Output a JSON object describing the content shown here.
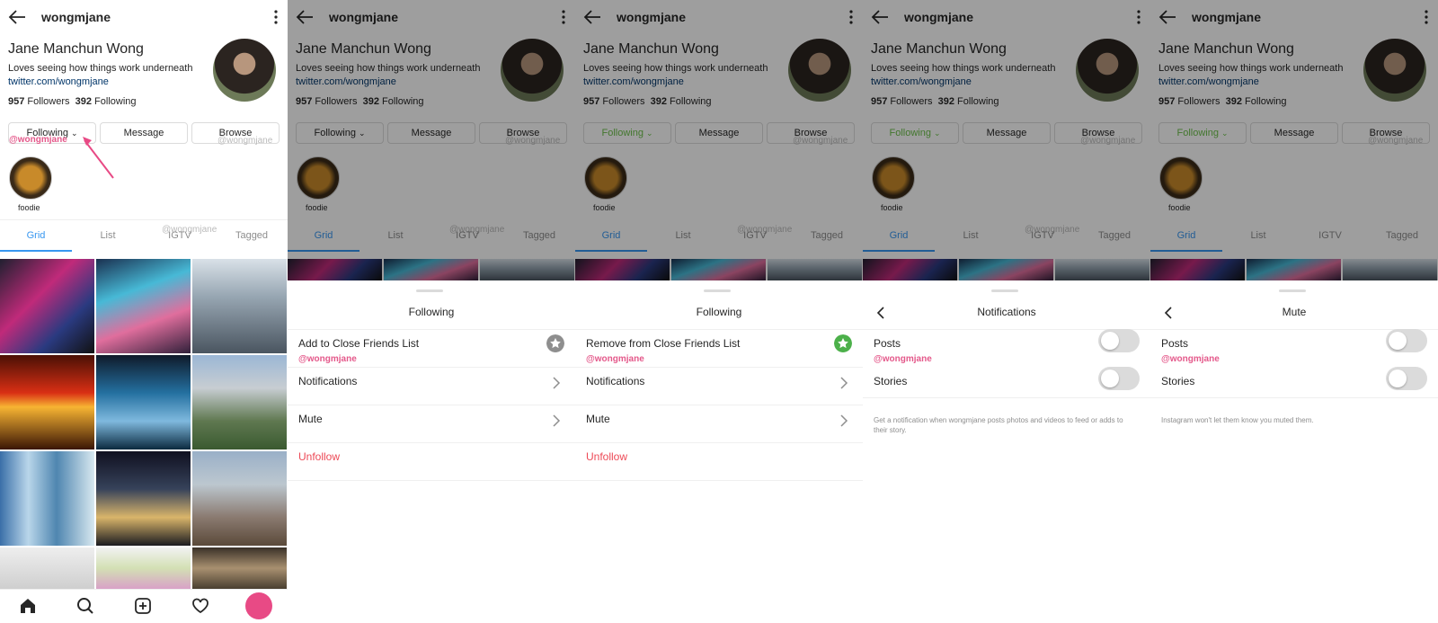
{
  "profile": {
    "username": "wongmjane",
    "full_name": "Jane Manchun Wong",
    "bio": "Loves seeing how things work underneath",
    "link": "twitter.com/wongmjane",
    "followers_count": "957",
    "followers_label": "Followers",
    "following_count": "392",
    "following_label": "Following",
    "btn_following": "Following",
    "btn_message": "Message",
    "btn_browse": "Browse",
    "highlight_label": "foodie"
  },
  "watermark": "@wongmjane",
  "tabs": [
    "Grid",
    "List",
    "IGTV",
    "Tagged"
  ],
  "sheet_following": {
    "title": "Following",
    "add_close_friends": "Add to Close Friends List",
    "remove_close_friends": "Remove from Close Friends List",
    "notifications": "Notifications",
    "mute": "Mute",
    "unfollow": "Unfollow"
  },
  "sheet_notifications": {
    "title": "Notifications",
    "posts": "Posts",
    "stories": "Stories",
    "note": "Get a notification when wongmjane posts photos and videos to feed or adds to their story."
  },
  "sheet_mute": {
    "title": "Mute",
    "posts": "Posts",
    "stories": "Stories",
    "note": "Instagram won't let them know you muted them."
  },
  "colors": {
    "accent_blue": "#3897f0",
    "unfollow_red": "#ed4956",
    "watermark_pink": "#e4588a",
    "close_friends_green": "#4cb04a",
    "following_green": "#6cc04a"
  },
  "icons": [
    "back-arrow-icon",
    "more-vertical-icon",
    "chevron-down-icon",
    "chevron-right-icon",
    "star-icon",
    "home-icon",
    "search-icon",
    "add-post-icon",
    "heart-icon"
  ]
}
